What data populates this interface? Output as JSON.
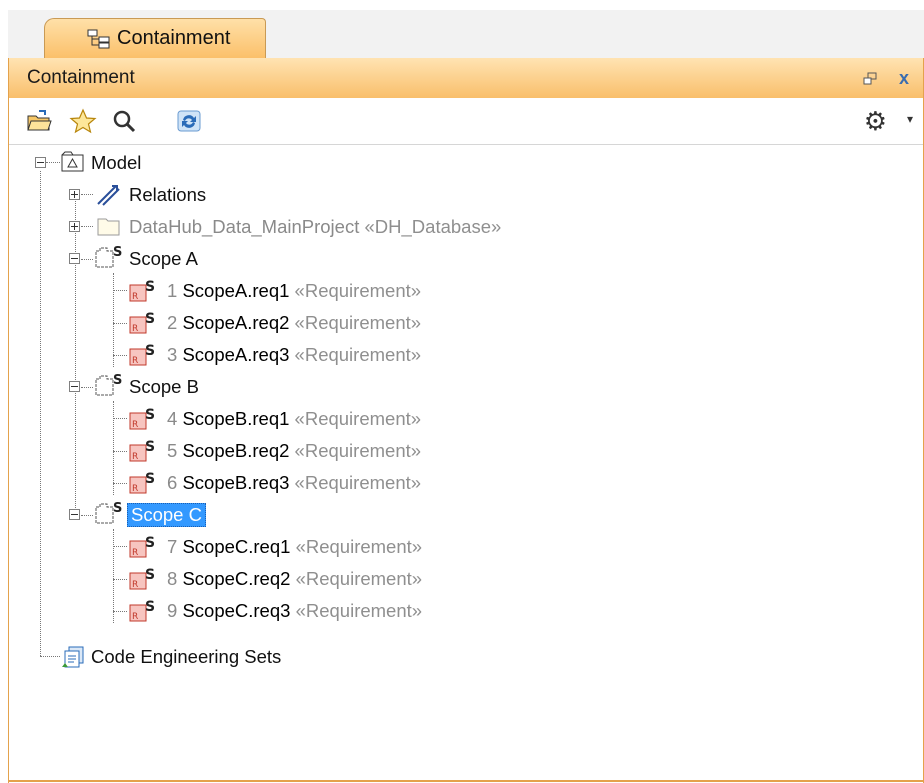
{
  "tab": {
    "label": "Containment"
  },
  "panel": {
    "title": "Containment",
    "restore_icon": "restore-icon",
    "close_label": "x"
  },
  "toolbar": {
    "icons": [
      "open-folder-icon",
      "star-icon",
      "search-icon",
      "sync-icon"
    ],
    "gear_icon": "gear-icon",
    "dropdown_glyph": "▾"
  },
  "tree": {
    "model": {
      "label": "Model",
      "icon": "model-icon"
    },
    "relations": {
      "label": "Relations",
      "icon": "relations-icon"
    },
    "datahub": {
      "label": "DataHub_Data_MainProject",
      "stereotype": "«DH_Database»",
      "icon": "folder-icon"
    },
    "scopes": [
      {
        "label": "Scope A",
        "icon": "package-icon",
        "items": [
          {
            "num": "1",
            "name": "ScopeA.req1",
            "stereotype": "«Requirement»"
          },
          {
            "num": "2",
            "name": "ScopeA.req2",
            "stereotype": "«Requirement»"
          },
          {
            "num": "3",
            "name": "ScopeA.req3",
            "stereotype": "«Requirement»"
          }
        ]
      },
      {
        "label": "Scope B",
        "icon": "package-icon",
        "items": [
          {
            "num": "4",
            "name": "ScopeB.req1",
            "stereotype": "«Requirement»"
          },
          {
            "num": "5",
            "name": "ScopeB.req2",
            "stereotype": "«Requirement»"
          },
          {
            "num": "6",
            "name": "ScopeB.req3",
            "stereotype": "«Requirement»"
          }
        ]
      },
      {
        "label": "Scope C",
        "icon": "package-icon",
        "selected": true,
        "items": [
          {
            "num": "7",
            "name": "ScopeC.req1",
            "stereotype": "«Requirement»"
          },
          {
            "num": "8",
            "name": "ScopeC.req2",
            "stereotype": "«Requirement»"
          },
          {
            "num": "9",
            "name": "ScopeC.req3",
            "stereotype": "«Requirement»"
          }
        ]
      }
    ],
    "code_sets": {
      "label": "Code Engineering Sets",
      "icon": "code-engineering-icon"
    }
  },
  "colors": {
    "accent": "#f9bf6b",
    "selection": "#3399ff",
    "requirement_icon": "#c0392b",
    "stereotype_text": "#8f8f8f"
  }
}
